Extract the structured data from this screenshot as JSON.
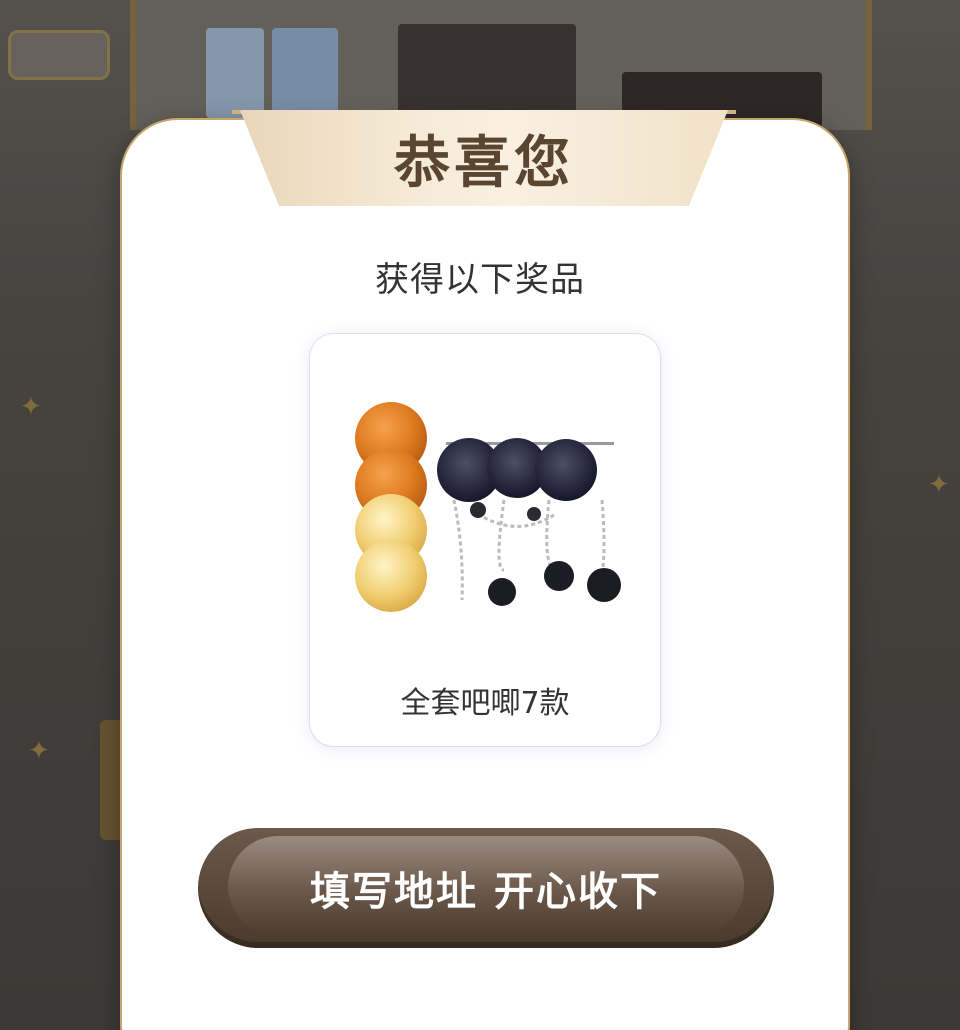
{
  "modal": {
    "banner_title": "恭喜您",
    "subtitle": "获得以下奖品",
    "prize": {
      "name": "全套吧唧7款"
    },
    "cta_label": "填写地址 开心收下"
  },
  "colors": {
    "banner_text": "#5a4630",
    "cta_dark": "#4a3a2c",
    "modal_border": "#c7a76b"
  }
}
